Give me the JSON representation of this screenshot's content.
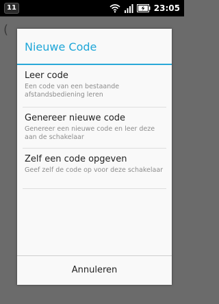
{
  "statusbar": {
    "badge": "11",
    "time": "23:05",
    "icons": [
      "wifi-icon",
      "signal-icon",
      "battery-charging-icon"
    ]
  },
  "dialog": {
    "title": "Nieuwe Code",
    "accent_color": "#1ea6d8",
    "options": [
      {
        "title": "Leer code",
        "description": "Een code van een bestaande afstandsbediening leren"
      },
      {
        "title": "Genereer nieuwe code",
        "description": "Genereer een nieuwe code en leer deze aan de schakelaar"
      },
      {
        "title": "Zelf een code opgeven",
        "description": "Geef zelf de code op voor deze schakelaar"
      }
    ],
    "cancel_label": "Annuleren"
  }
}
